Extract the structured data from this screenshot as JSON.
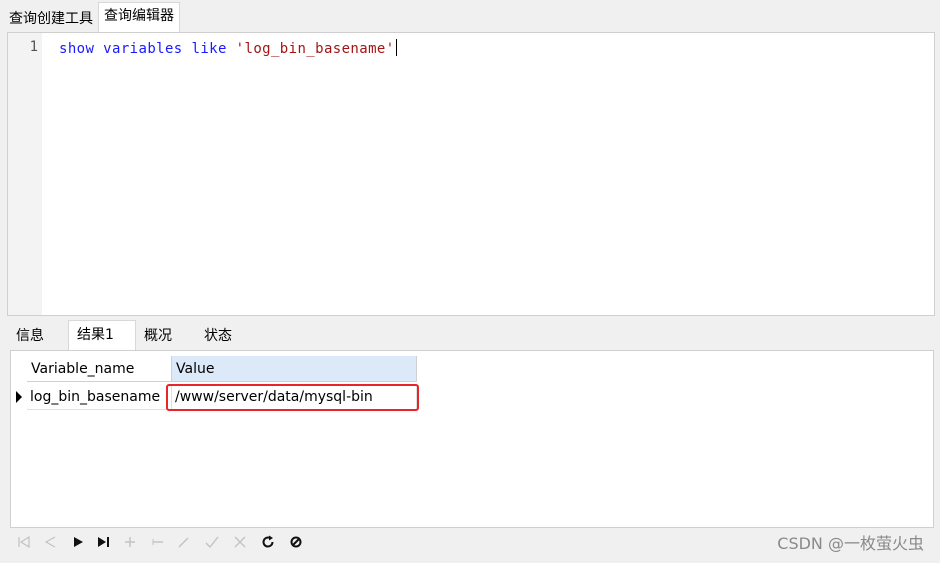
{
  "top_tabs": [
    {
      "label": "查询创建工具"
    },
    {
      "label": "查询编辑器"
    }
  ],
  "editor": {
    "line_number": "1",
    "code_keyword1": "show",
    "code_space1": " ",
    "code_keyword2": "variables",
    "code_space2": " ",
    "code_keyword3": "like",
    "code_space3": " ",
    "code_string": "'log_bin_basename'"
  },
  "result_tabs": [
    {
      "label": "信息"
    },
    {
      "label": "结果1"
    },
    {
      "label": "概况"
    },
    {
      "label": "状态"
    }
  ],
  "grid": {
    "columns": [
      "Variable_name",
      "Value"
    ],
    "rows": [
      [
        "log_bin_basename",
        "/www/server/data/mysql-bin"
      ]
    ]
  },
  "toolbar": {
    "icons": [
      "first-record-icon",
      "prev-record-icon",
      "next-record-icon",
      "last-record-icon",
      "add-record-icon",
      "delete-record-icon",
      "edit-record-icon",
      "apply-icon",
      "cancel-icon",
      "refresh-icon",
      "stop-icon"
    ]
  },
  "watermark": "CSDN @一枚萤火虫",
  "colors": {
    "keyword": "#1a1aff",
    "string": "#a31515",
    "highlight_border": "#e8262a",
    "selected_header": "#dbe9f9"
  }
}
